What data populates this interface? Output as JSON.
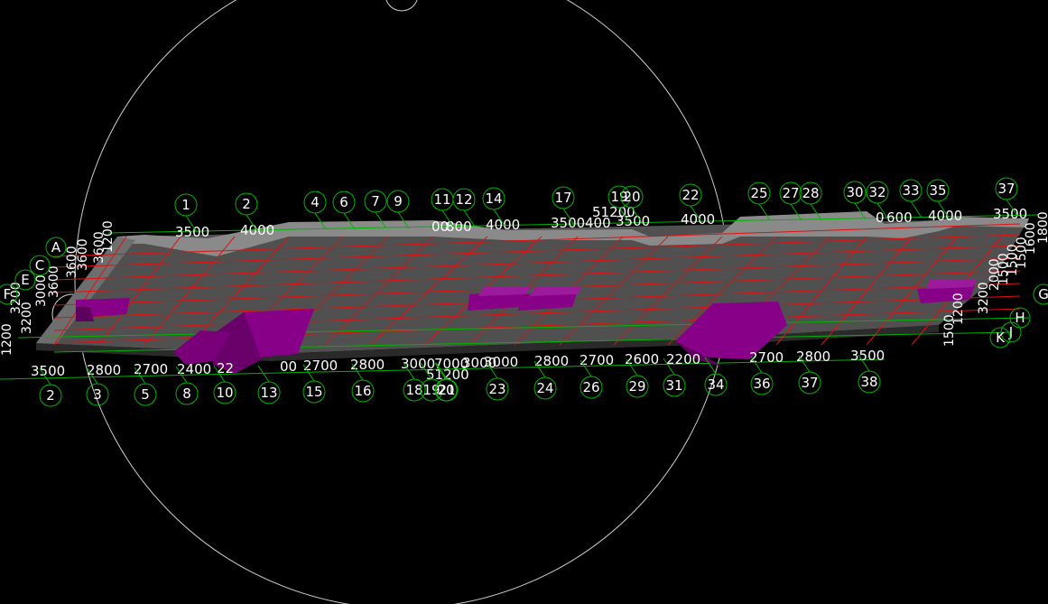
{
  "colors": {
    "background": "#000000",
    "grid_line": "#00b400",
    "beam_line": "#e01010",
    "slab": "#505050",
    "slab_edge": "#8c8c8c",
    "column": "#880088",
    "column_dark": "#5e005e",
    "orbit_circle": "#d0d0d0",
    "label_text": "#ffffff"
  },
  "top_axis": {
    "bubble_labels": [
      "1",
      "2",
      "4",
      "6",
      "7",
      "9",
      "11",
      "12",
      "14",
      "17",
      "19",
      "20",
      "22",
      "25",
      "27",
      "28",
      "30",
      "32",
      "33",
      "35",
      "37"
    ],
    "dimension_labels": [
      "3500",
      "4000",
      "00",
      "800",
      "4000",
      "3500",
      "400",
      "3500",
      "4000",
      "0",
      "600",
      "4000",
      "3500"
    ],
    "total_label": "51200"
  },
  "bottom_axis": {
    "bubble_labels": [
      "2",
      "3",
      "5",
      "8",
      "10",
      "13",
      "15",
      "16",
      "18",
      "19",
      "20",
      "21",
      "23",
      "24",
      "26",
      "29",
      "31",
      "34",
      "36",
      "37",
      "38"
    ],
    "dimension_labels": [
      "3500",
      "2800",
      "2700",
      "2400",
      "22",
      "00",
      "2700",
      "2800",
      "3000",
      "7000",
      "3000",
      "3000",
      "2800",
      "2700",
      "2600",
      "2200",
      "2700",
      "2800",
      "3500"
    ],
    "total_label": "51200"
  },
  "left_axis": {
    "bubble_labels": [
      "A",
      "C",
      "E",
      "F"
    ],
    "dimension_labels": [
      "1200",
      "3200",
      "3000",
      "3600",
      "3200",
      "3600",
      "3600",
      "3600",
      "1200"
    ]
  },
  "right_axis": {
    "bubble_labels": [
      "G",
      "H",
      "J",
      "K"
    ],
    "dimension_labels": [
      "1800",
      "1600",
      "1500",
      "1500",
      "1500",
      "2000",
      "3200",
      "1200",
      "1500"
    ]
  }
}
